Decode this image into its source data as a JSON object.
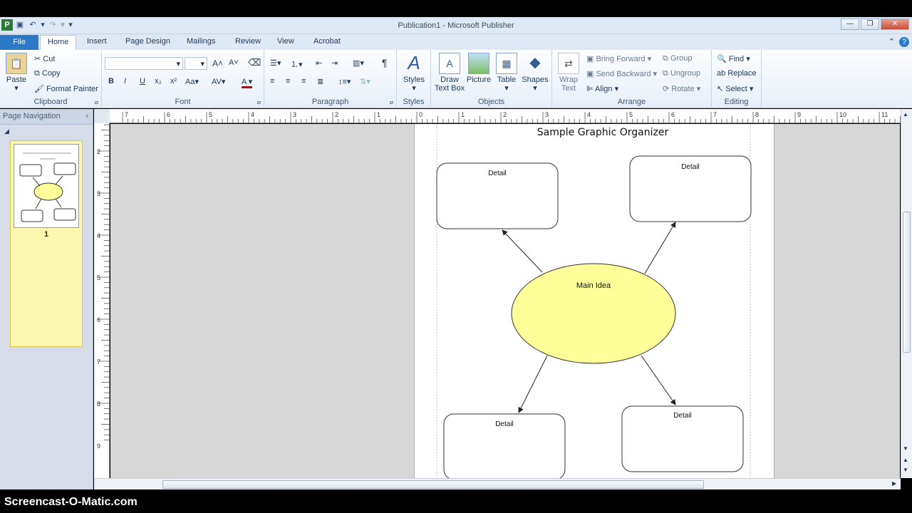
{
  "window": {
    "title": "Publication1  -  Microsoft Publisher"
  },
  "tabs": {
    "file": "File",
    "home": "Home",
    "insert": "Insert",
    "page_design": "Page Design",
    "mailings": "Mailings",
    "review": "Review",
    "view": "View",
    "acrobat": "Acrobat"
  },
  "clipboard": {
    "paste": "Paste",
    "cut": "Cut",
    "copy": "Copy",
    "format_painter": "Format Painter",
    "label": "Clipboard"
  },
  "font": {
    "label": "Font",
    "bold": "B",
    "italic": "I",
    "underline": "U"
  },
  "paragraph": {
    "label": "Paragraph",
    "pilcrow": "¶"
  },
  "styles": {
    "styles_btn": "Styles",
    "label": "Styles"
  },
  "objects": {
    "draw_text_box_1": "Draw",
    "draw_text_box_2": "Text Box",
    "picture": "Picture",
    "table": "Table",
    "shapes": "Shapes",
    "label": "Objects"
  },
  "arrange": {
    "wrap_text_1": "Wrap",
    "wrap_text_2": "Text",
    "bring_forward": "Bring Forward",
    "send_backward": "Send Backward",
    "align": "Align",
    "group": "Group",
    "ungroup": "Ungroup",
    "rotate": "Rotate",
    "label": "Arrange"
  },
  "editing": {
    "find": "Find",
    "replace": "Replace",
    "select": "Select",
    "label": "Editing"
  },
  "nav": {
    "header": "Page Navigation",
    "page_number": "1"
  },
  "ruler": {
    "h_ticks": [
      "7",
      "6",
      "5",
      "4",
      "3",
      "2",
      "1",
      "0",
      "1",
      "2",
      "3",
      "4",
      "5",
      "6",
      "7",
      "8",
      "9",
      "10",
      "11"
    ],
    "v_ticks": [
      "2",
      "3",
      "4",
      "5",
      "6",
      "7",
      "8",
      "9"
    ]
  },
  "document": {
    "title": "Sample Graphic Organizer",
    "main_idea": "Main Idea",
    "detail_tl": "Detail",
    "detail_tr": "Detail",
    "detail_bl": "Detail",
    "detail_br": "Detail",
    "colors": {
      "ellipse_fill": "#ffff99",
      "box_border": "#333333"
    }
  },
  "watermark": "Screencast-O-Matic.com"
}
